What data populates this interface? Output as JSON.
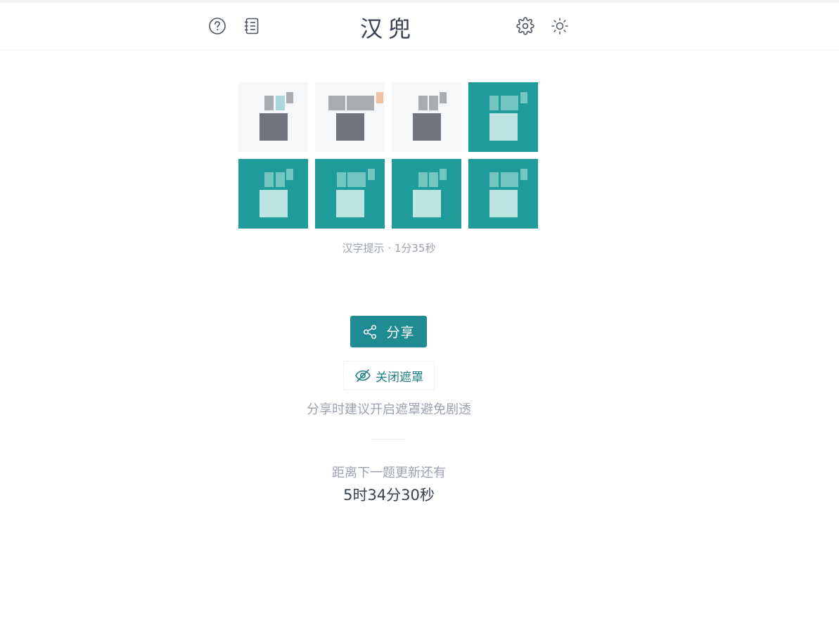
{
  "header": {
    "title": "汉兜",
    "left_icons": [
      "help-icon",
      "notebook-icon"
    ],
    "right_icons": [
      "gear-icon",
      "sun-icon"
    ]
  },
  "grid": {
    "tiles": [
      {
        "state": "partial"
      },
      {
        "state": "partial"
      },
      {
        "state": "partial"
      },
      {
        "state": "correct"
      },
      {
        "state": "correct"
      },
      {
        "state": "correct"
      },
      {
        "state": "correct"
      },
      {
        "state": "correct"
      }
    ],
    "colors": {
      "correct_bg": "#1f9c9a",
      "empty_bg": "#f6f7f9",
      "gray_block": "#6f7480",
      "light_gray_block": "#a9acb1",
      "teal_hint": "#a9d8da",
      "orange_hint": "#f0c29f"
    }
  },
  "hint_text": "汉字提示 · 1分35秒",
  "share": {
    "label": "分享",
    "icon": "share-icon"
  },
  "mask": {
    "label": "关闭遮罩",
    "icon": "eye-off-icon"
  },
  "tip": "分享时建议开启遮罩避免剧透",
  "next": {
    "label": "距离下一题更新还有",
    "countdown": "5时34分30秒"
  }
}
